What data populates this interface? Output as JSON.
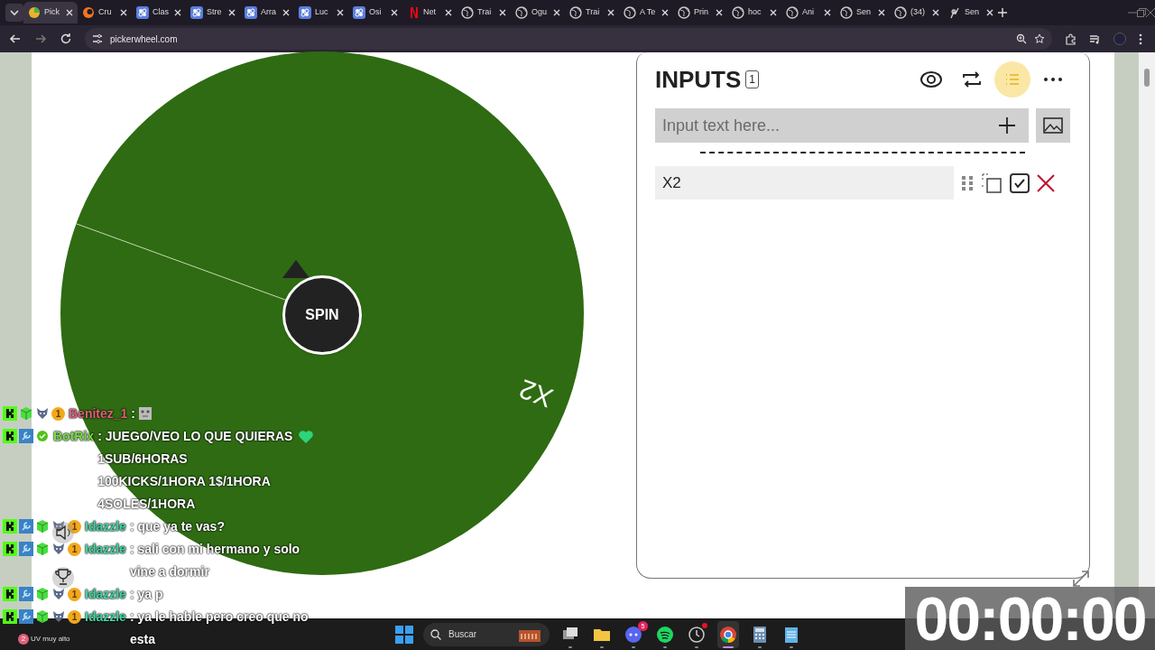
{
  "browser": {
    "tabs": [
      {
        "title": "Pick",
        "kind": "wheel",
        "selected": true
      },
      {
        "title": "Cru",
        "kind": "crunchy",
        "selected": false
      },
      {
        "title": "Clas",
        "kind": "app",
        "selected": false
      },
      {
        "title": "Stre",
        "kind": "app",
        "selected": false
      },
      {
        "title": "Arra",
        "kind": "app",
        "selected": false
      },
      {
        "title": "Luc",
        "kind": "app",
        "selected": false
      },
      {
        "title": "Osi",
        "kind": "app",
        "selected": false
      },
      {
        "title": "Net",
        "kind": "netflix",
        "selected": false
      },
      {
        "title": "Trai",
        "kind": "globe",
        "selected": false
      },
      {
        "title": "Ogu",
        "kind": "globe",
        "selected": false
      },
      {
        "title": "Trai",
        "kind": "globe",
        "selected": false
      },
      {
        "title": "A Te",
        "kind": "globe",
        "selected": false
      },
      {
        "title": "Prin",
        "kind": "globe",
        "selected": false
      },
      {
        "title": "hoc",
        "kind": "globe",
        "selected": false
      },
      {
        "title": "Ani",
        "kind": "globe",
        "selected": false
      },
      {
        "title": "Sen",
        "kind": "globe",
        "selected": false
      },
      {
        "title": "(34)",
        "kind": "globe",
        "selected": false
      },
      {
        "title": "Sen",
        "kind": "figure",
        "selected": false
      }
    ],
    "address": "pickerwheel.com"
  },
  "wheel": {
    "segments": [
      {
        "label": "X2"
      }
    ],
    "spin_label": "SPIN"
  },
  "inputs": {
    "title": "INPUTS",
    "count": "1",
    "toolbar": [
      {
        "kind": "eye",
        "selected": false
      },
      {
        "kind": "shuffle",
        "selected": false
      },
      {
        "kind": "list",
        "selected": true
      },
      {
        "kind": "more",
        "selected": false
      }
    ],
    "placeholder": "Input text here...",
    "entries": [
      {
        "label": "X2",
        "checked": true
      }
    ]
  },
  "chat": [
    {
      "kind": "emote",
      "user": "Benitez_1",
      "color": "#e0607a",
      "coin": "1",
      "text": ":"
    },
    {
      "kind": "bot",
      "user": "BotRix",
      "color": "#7be04a",
      "text": ": JUEGO/VEO LO QUE QUIERAS 1SUB/6HORAS 100KICKS/1HORA 1$/1HORA 4SOLES/1HORA"
    },
    {
      "kind": "viewer",
      "user": "Idazzle",
      "color": "#3fd6a0",
      "coin": "1",
      "text": ": que ya te vas?"
    },
    {
      "kind": "viewer",
      "user": "Idazzle",
      "color": "#3fd6a0",
      "coin": "1",
      "text": ": sali con mi hermano y solo vine a dormir"
    },
    {
      "kind": "viewer",
      "user": "Idazzle",
      "color": "#3fd6a0",
      "coin": "1",
      "text": ": ya p"
    },
    {
      "kind": "viewer",
      "user": "Idazzle",
      "color": "#3fd6a0",
      "coin": "1",
      "text": ": ya le hable pero creo que no esta"
    }
  ],
  "timer": "00:00:00",
  "taskbar": {
    "weather": {
      "badge": "2",
      "text": "UV muy alto"
    },
    "search_placeholder": "Buscar",
    "apps": [
      {
        "kind": "taskview",
        "selected": false
      },
      {
        "kind": "folder",
        "selected": false
      },
      {
        "kind": "discord",
        "selected": false,
        "badge": "5"
      },
      {
        "kind": "spotify",
        "selected": false
      },
      {
        "kind": "clock",
        "selected": false,
        "alert": true
      },
      {
        "kind": "chrome",
        "selected": true
      },
      {
        "kind": "calculator",
        "selected": false
      },
      {
        "kind": "notepad",
        "selected": false
      }
    ]
  }
}
